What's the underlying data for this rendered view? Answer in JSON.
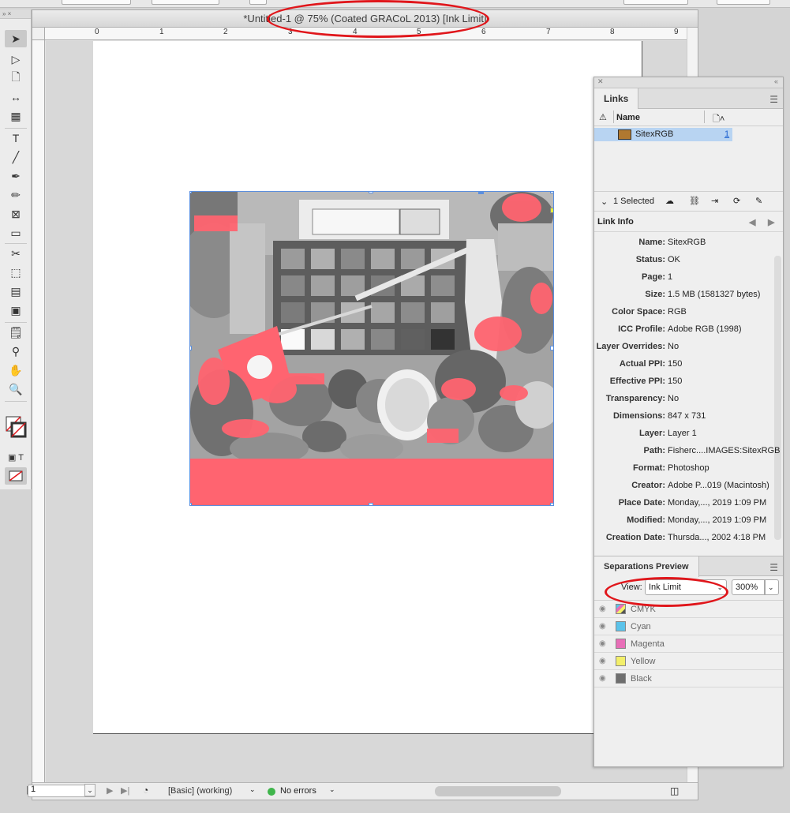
{
  "document": {
    "title": "*Untitled-1 @ 75% (Coated GRACoL 2013) [Ink Limit]",
    "ruler_numbers": [
      "0",
      "1",
      "2",
      "3",
      "4",
      "5",
      "6",
      "7",
      "8",
      "9"
    ]
  },
  "status_bar": {
    "page_number": "1",
    "profile": "[Basic] (working)",
    "preflight": "No errors"
  },
  "links_panel": {
    "tab": "Links",
    "column_name": "Name",
    "items": [
      {
        "name": "SitexRGB",
        "page": "1"
      }
    ],
    "selected_count": "1 Selected",
    "link_info_title": "Link Info",
    "info": [
      {
        "label": "Name:",
        "value": "SitexRGB"
      },
      {
        "label": "Status:",
        "value": "OK"
      },
      {
        "label": "Page:",
        "value": "1"
      },
      {
        "label": "Size:",
        "value": "1.5 MB (1581327 bytes)"
      },
      {
        "label": "Color Space:",
        "value": "RGB"
      },
      {
        "label": "ICC Profile:",
        "value": "Adobe RGB (1998)"
      },
      {
        "label": "Layer Overrides:",
        "value": "No"
      },
      {
        "label": "Actual PPI:",
        "value": "150"
      },
      {
        "label": "Effective PPI:",
        "value": "150"
      },
      {
        "label": "Transparency:",
        "value": "No"
      },
      {
        "label": "Dimensions:",
        "value": "847 x 731"
      },
      {
        "label": "Layer:",
        "value": "Layer 1"
      },
      {
        "label": "Path:",
        "value": "Fisherc....IMAGES:SitexRGB"
      },
      {
        "label": "Format:",
        "value": "Photoshop"
      },
      {
        "label": "Creator:",
        "value": "Adobe P...019 (Macintosh)"
      },
      {
        "label": "Place Date:",
        "value": "Monday,..., 2019 1:09 PM"
      },
      {
        "label": "Modified:",
        "value": "Monday,..., 2019 1:09 PM"
      },
      {
        "label": "Creation Date:",
        "value": "Thursda..., 2002 4:18 PM"
      }
    ]
  },
  "separations_panel": {
    "tab": "Separations Preview",
    "view_label": "View:",
    "view_value": "Ink Limit",
    "ink_limit": "300%",
    "plates": [
      {
        "name": "CMYK",
        "color": ""
      },
      {
        "name": "Cyan",
        "color": "#5bc3ea"
      },
      {
        "name": "Magenta",
        "color": "#e86fb8"
      },
      {
        "name": "Yellow",
        "color": "#f3ef6a"
      },
      {
        "name": "Black",
        "color": "#6e6e6e"
      }
    ]
  },
  "colors": {
    "ink_limit_overlay": "#ff6470",
    "selection": "#5b8fde",
    "annotation": "#e0161b"
  }
}
